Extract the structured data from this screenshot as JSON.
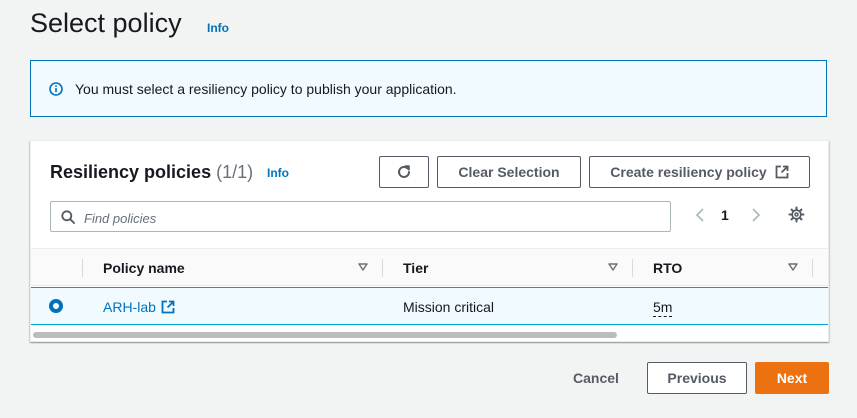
{
  "page": {
    "title": "Select policy",
    "info": "Info"
  },
  "alert": {
    "icon": "info-circle-icon",
    "text": "You must select a resiliency policy to publish your application."
  },
  "panel": {
    "title": "Resiliency policies",
    "count": "(1/1)",
    "info": "Info",
    "refresh_icon": "refresh-icon",
    "clear_selection": "Clear Selection",
    "create_policy": "Create resiliency policy",
    "create_policy_icon": "external-link-icon"
  },
  "search": {
    "placeholder": "Find policies",
    "value": ""
  },
  "pagination": {
    "current_page": "1"
  },
  "table": {
    "columns": [
      "Policy name",
      "Tier",
      "RTO"
    ],
    "rows": [
      {
        "selected": true,
        "policy_name": "ARH-lab",
        "tier": "Mission critical",
        "rto": "5m"
      }
    ]
  },
  "footer": {
    "cancel": "Cancel",
    "previous": "Previous",
    "next": "Next"
  },
  "colors": {
    "link": "#0073bb",
    "primary_button": "#ec7211",
    "selected_row": "#f1faff"
  }
}
